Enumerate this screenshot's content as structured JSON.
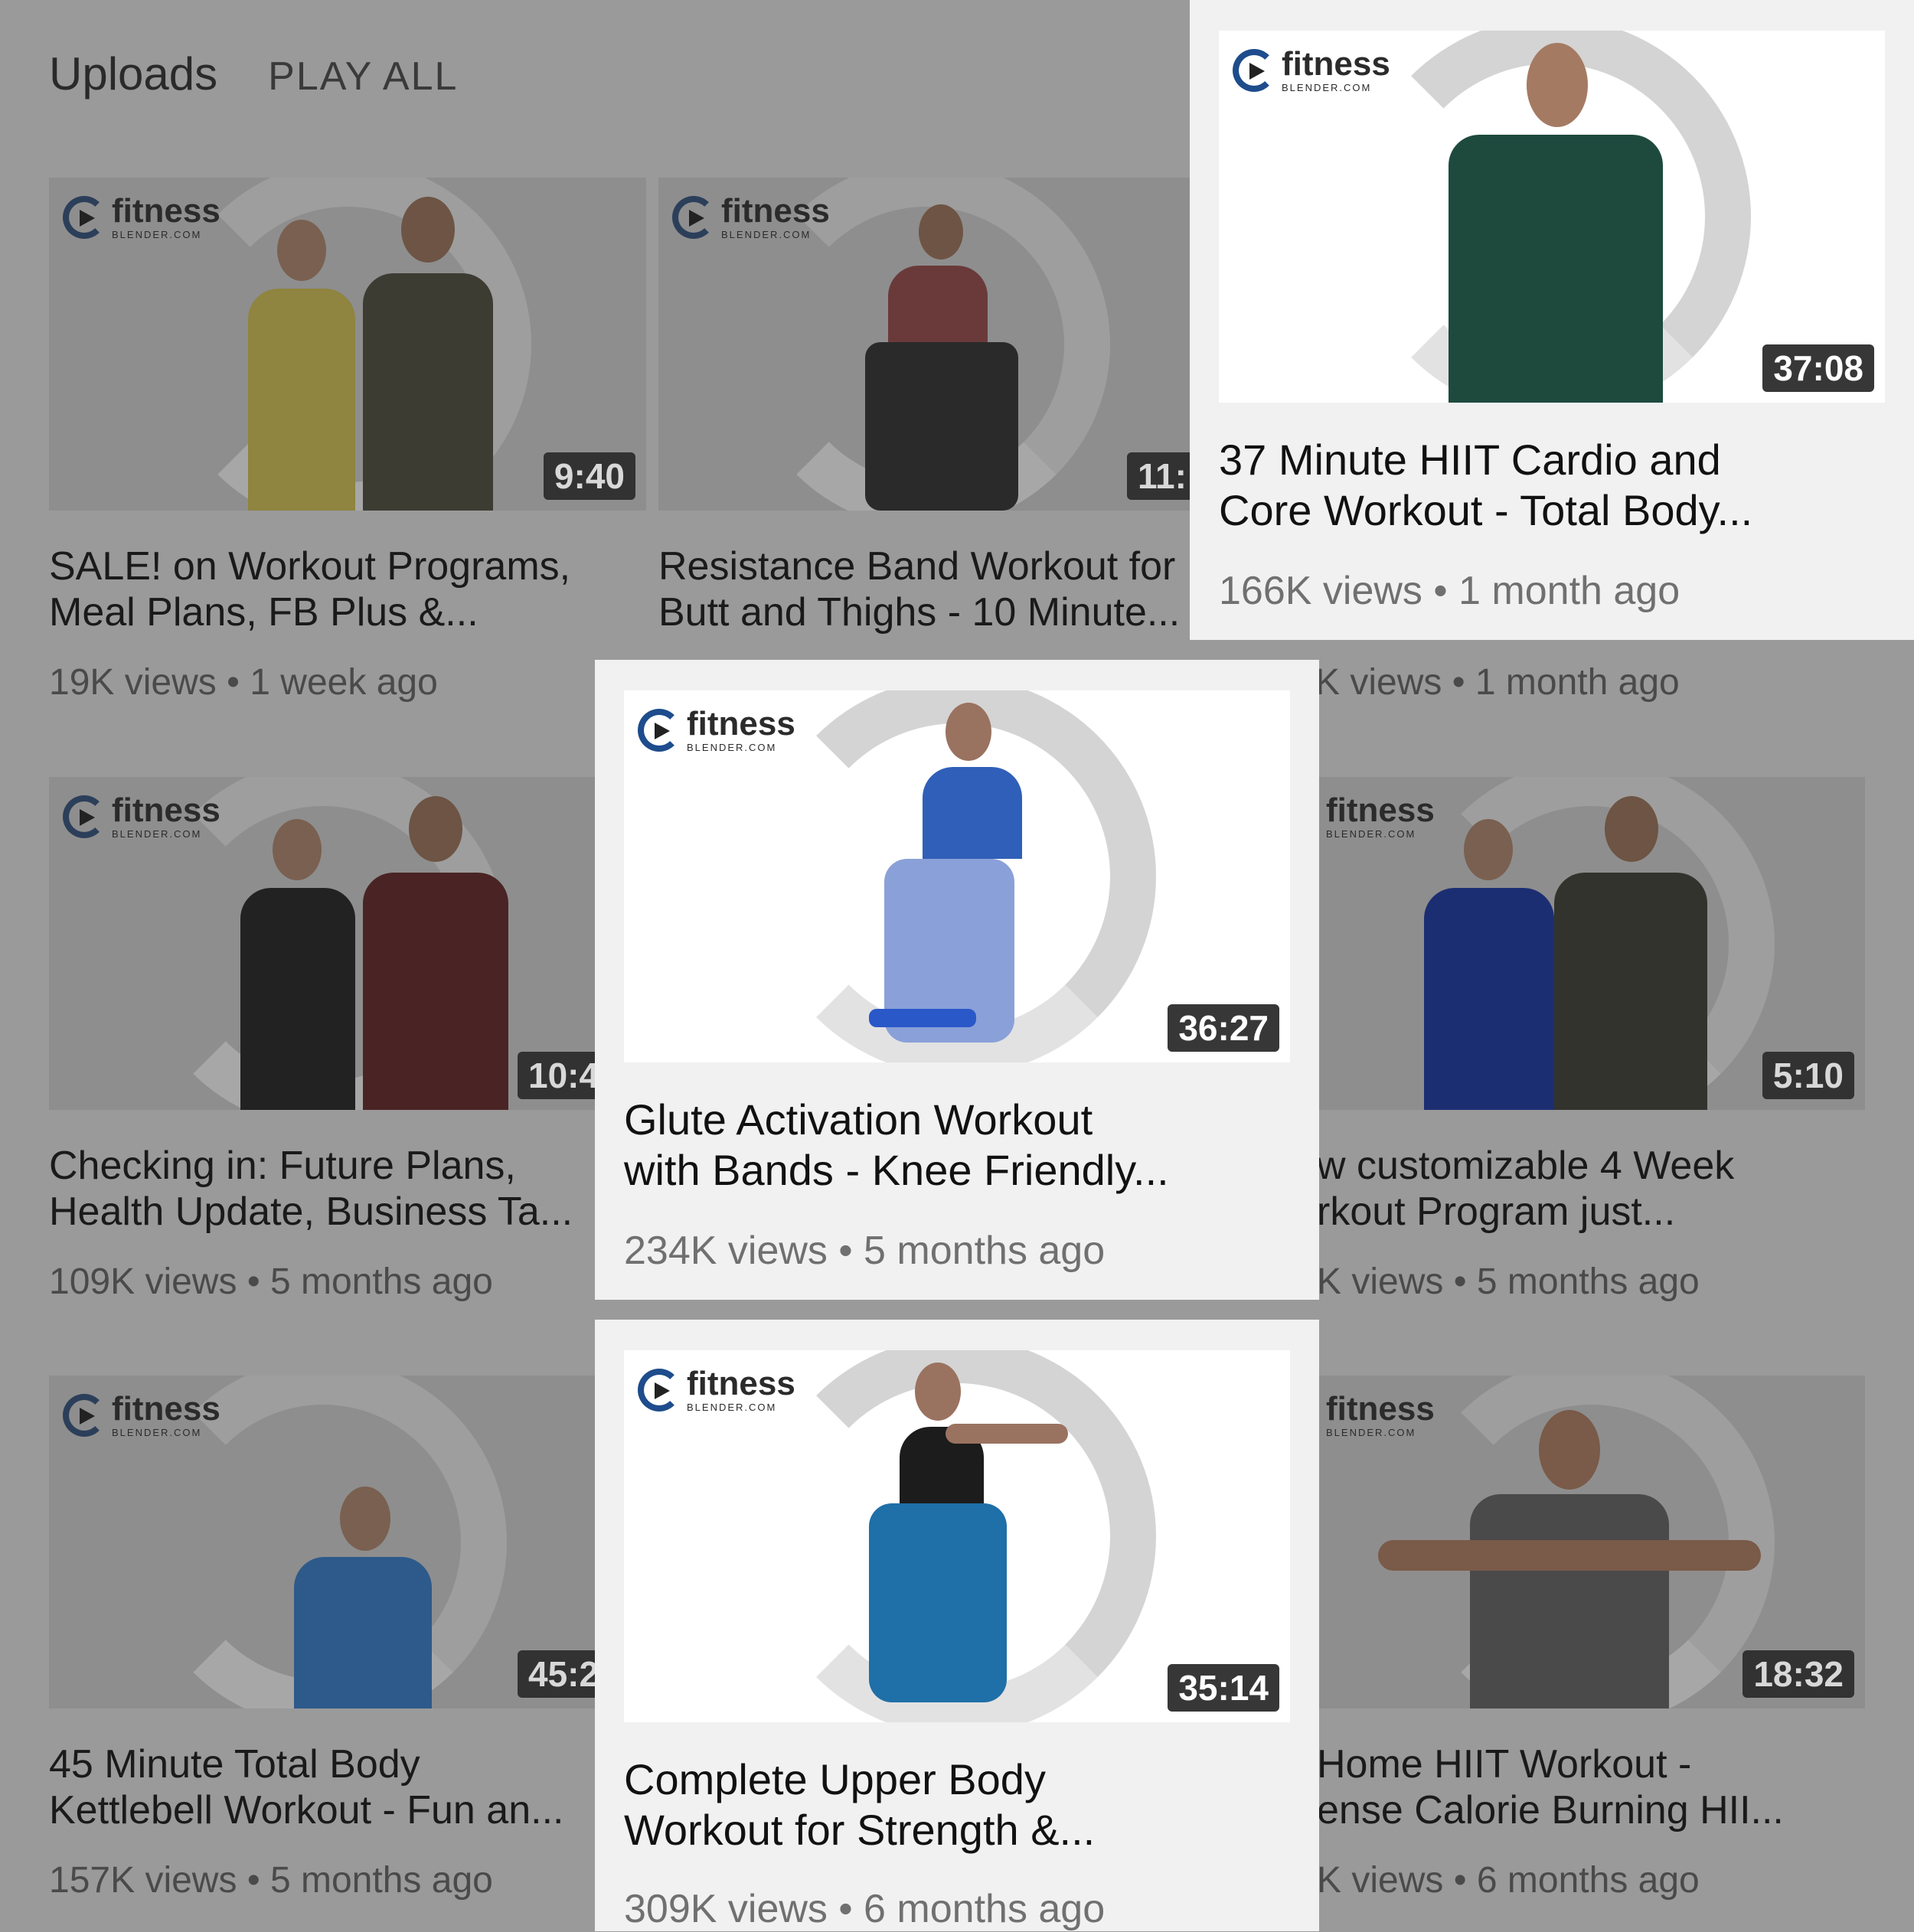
{
  "header": {
    "title": "Uploads",
    "play_all": "PLAY ALL"
  },
  "logo": {
    "main": "fitness",
    "sub": "BLENDER.COM"
  },
  "videos": [
    {
      "title": "SALE! on Workout Programs,\nMeal Plans, FB Plus &...",
      "duration": "9:40",
      "views": "19K views",
      "age": "1 week ago"
    },
    {
      "title": "Resistance Band Workout for\nButt and Thighs - 10 Minute...",
      "duration": "11:",
      "views": "",
      "age": ""
    },
    {
      "title": "37 Minute HIIT Cardio and\nCore Workout - Total Body...",
      "duration": "37:08",
      "views": "166K views",
      "age": "1 month ago"
    },
    {
      "title": "Checking in: Future Plans,\nHealth Update, Business Ta...",
      "duration": "10:4",
      "views": "109K views",
      "age": "5 months ago"
    },
    {
      "title": "Glute Activation Workout\nwith Bands - Knee Friendly...",
      "duration": "36:27",
      "views": "234K views",
      "age": "5 months ago"
    },
    {
      "title": "w customizable 4 Week\nrkout Program just...",
      "duration": "5:10",
      "views": "K views",
      "age": "5 months ago"
    },
    {
      "title": "45 Minute Total Body\nKettlebell Workout - Fun an...",
      "duration": "45:2",
      "views": "157K views",
      "age": "5 months ago"
    },
    {
      "title": "Complete Upper Body\nWorkout for Strength &...",
      "duration": "35:14",
      "views": "309K views",
      "age": "6 months ago"
    },
    {
      "title": "Home HIIT Workout -\nense Calorie Burning HII...",
      "duration": "18:32",
      "views": "K views",
      "age": "6 months ago"
    }
  ],
  "partial_meta": {
    "row1_right": "K views",
    "row1_right_age": "1 month ago"
  },
  "separator": "•"
}
